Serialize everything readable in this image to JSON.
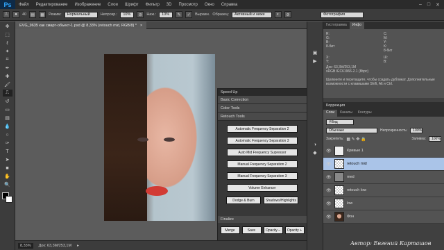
{
  "menubar": {
    "logo": "Ps",
    "items": [
      "Файл",
      "Редактирование",
      "Изображение",
      "Слои",
      "Шрифт",
      "Фильтр",
      "3D",
      "Просмотр",
      "Окно",
      "Справка"
    ],
    "controls": [
      "–",
      "□",
      "✕"
    ]
  },
  "options": {
    "brush_size": "40",
    "mode_label": "Режим:",
    "mode_value": "Нормальный",
    "opacity_label": "Непрозр.:",
    "opacity_value": "10%",
    "flow_label": "Наж.:",
    "flow_value": "10%",
    "align_label": "Выравн.",
    "sample_label": "Образец:",
    "sample_value": "Активный и ниже",
    "workspace": "Фотография"
  },
  "document": {
    "tab_title": "EVG_9635 как смарт-объект-1.psd @ 8,33% (retouch mid, RGB/8) *",
    "close": "×"
  },
  "status": {
    "zoom": "8,33%",
    "doc_size": "Док: 63,3M/253,1M"
  },
  "speedup": {
    "title": "Speed Up",
    "sections": [
      "Basic Correction",
      "Color Tools",
      "Retouch Tools"
    ],
    "buttons": [
      "Automatic Frequency Separation 2",
      "Automatic Frequency Separation 3",
      "Auto Mid Frequency Supressor",
      "Manual Frequency Separation 2",
      "Manual Frequency Separation 3",
      "Volume Enhancer"
    ],
    "row_buttons": [
      "Dodge & Burn",
      "Shadows/Highlights"
    ],
    "finalize": "Finalize",
    "bottom_buttons": [
      "Merge",
      "Save",
      "Opacity –",
      "Opacity +"
    ]
  },
  "panel": {
    "tabs": [
      "Гистограмма",
      "Инфо"
    ],
    "info": {
      "r": "R:",
      "g": "G:",
      "b": "B:",
      "c": "C:",
      "m": "M:",
      "y": "Y:",
      "k": "K:",
      "bit1": "8-бит",
      "bit2": "8-бит",
      "x": "X:",
      "y2": "Y:",
      "w": "Ш:",
      "h": "В:",
      "doc": "Док: 63,3M/253,1M",
      "profile": "sRGB IEC61966-2.1 (8bpc)",
      "hint": "Щелкните и перетащите, чтобы создать дубликат. Дополнительные возможности с клавишами Shift, Alt и Ctrl."
    },
    "corrections_tab": "Коррекция",
    "layer_tabs": [
      "Слои",
      "Каналы",
      "Контуры"
    ],
    "kind": "Вид",
    "blend": "Обычные",
    "opacity_label": "Непрозрачность:",
    "opacity": "100%",
    "lock_label": "Закрепить:",
    "fill_label": "Заливка:",
    "fill": "100%",
    "layers": [
      {
        "name": "Кривые 1"
      },
      {
        "name": "retouch mid"
      },
      {
        "name": "med"
      },
      {
        "name": "retouch low"
      },
      {
        "name": "low"
      },
      {
        "name": "Фон"
      }
    ]
  },
  "watermark": "Автор: Евгений Карташов"
}
